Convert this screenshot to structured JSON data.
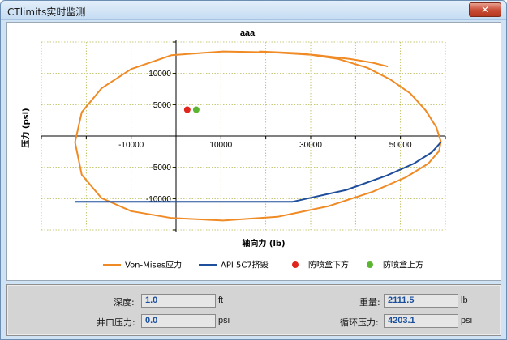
{
  "window": {
    "title": "CTlimits实时监测",
    "close_glyph": "✕"
  },
  "chart_data": {
    "type": "line",
    "title": "aaa",
    "xlabel": "轴向力 (lb)",
    "ylabel": "压力 (psi)",
    "xlim": [
      -30000,
      60000
    ],
    "ylim": [
      -15000,
      15000
    ],
    "x_ticks": [
      -30000,
      -20000,
      -10000,
      0,
      10000,
      20000,
      30000,
      40000,
      50000,
      60000
    ],
    "y_ticks": [
      -15000,
      -10000,
      -5000,
      0,
      5000,
      10000,
      15000
    ],
    "x_tick_labels": [
      {
        "value": -10000,
        "label": "-10000"
      },
      {
        "value": 10000,
        "label": "10000"
      },
      {
        "value": 30000,
        "label": "30000"
      },
      {
        "value": 50000,
        "label": "50000"
      }
    ],
    "y_tick_labels": [
      {
        "value": 10000,
        "label": "10000"
      },
      {
        "value": 5000,
        "label": "5000"
      },
      {
        "value": -5000,
        "label": "-5000"
      },
      {
        "value": -10000,
        "label": "-10000"
      }
    ],
    "grid": true,
    "legend_position": "bottom",
    "series": [
      {
        "name": "Von-Mises应力",
        "kind": "line",
        "color": "#f08a24",
        "x": [
          18500,
          27900,
          36200,
          42600,
          47800,
          52200,
          55600,
          58000,
          59000,
          58600,
          56200,
          51200,
          43800,
          34000,
          22600,
          10500,
          -1000,
          -10000,
          -16600,
          -21000,
          -22500,
          -21000,
          -16600,
          -10000,
          -1000,
          10500,
          21700,
          31500,
          38800,
          43800,
          47200
        ],
        "y": [
          13500,
          13200,
          12300,
          10900,
          9000,
          6800,
          4100,
          1400,
          -900,
          -2400,
          -4400,
          -6600,
          -8900,
          -11200,
          -12900,
          -13500,
          -13100,
          -12000,
          -9900,
          -6200,
          -1000,
          3800,
          7600,
          10700,
          12900,
          13500,
          13350,
          12900,
          12300,
          11700,
          11100
        ]
      },
      {
        "name": "API 5C7挤毁",
        "kind": "line",
        "color": "#1f4e9b",
        "x": [
          -22500,
          26000,
          38000,
          47000,
          53000,
          57000,
          59000
        ],
        "y": [
          -10500,
          -10500,
          -8600,
          -6300,
          -4400,
          -2600,
          -1000
        ]
      },
      {
        "name": "防喷盒下方",
        "kind": "point",
        "color": "#e0251c",
        "x": [
          2500
        ],
        "y": [
          4200
        ]
      },
      {
        "name": "防喷盒上方",
        "kind": "point",
        "color": "#5cb531",
        "x": [
          4500
        ],
        "y": [
          4200
        ]
      }
    ]
  },
  "info": {
    "depth": {
      "label": "深度:",
      "value": "1.0",
      "unit": "ft"
    },
    "wellhead": {
      "label": "井口压力:",
      "value": "0.0",
      "unit": "psi"
    },
    "weight": {
      "label": "重量:",
      "value": "2111.5",
      "unit": "lb"
    },
    "circ": {
      "label": "循环压力:",
      "value": "4203.1",
      "unit": "psi"
    }
  }
}
